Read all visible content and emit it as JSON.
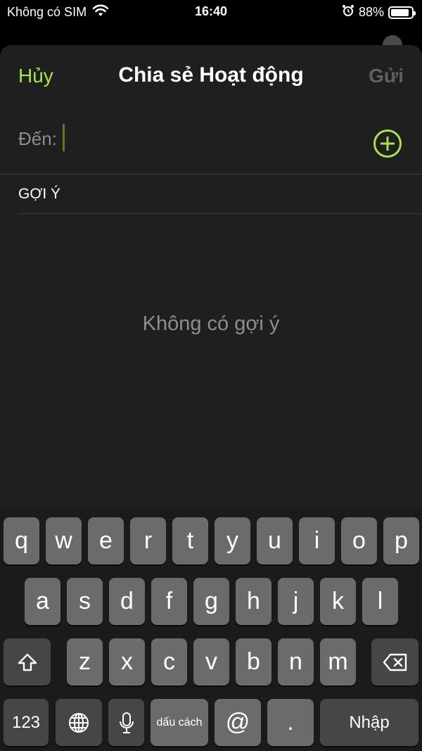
{
  "status_bar": {
    "carrier": "Không có SIM",
    "time": "16:40",
    "battery_percent": "88%",
    "battery_level": 0.88
  },
  "sheet": {
    "cancel_label": "Hủy",
    "title": "Chia sẻ Hoạt động",
    "send_label": "Gửi",
    "to_label": "Đến:",
    "section_header": "GỢI Ý",
    "empty_message": "Không có gợi ý"
  },
  "keyboard": {
    "row1": [
      "q",
      "w",
      "e",
      "r",
      "t",
      "y",
      "u",
      "i",
      "o",
      "p"
    ],
    "row2": [
      "a",
      "s",
      "d",
      "f",
      "g",
      "h",
      "j",
      "k",
      "l"
    ],
    "row3": [
      "z",
      "x",
      "c",
      "v",
      "b",
      "n",
      "m"
    ],
    "numbers_label": "123",
    "space_label": "dấu cách",
    "at_label": "@",
    "period_label": ".",
    "return_label": "Nhập"
  },
  "colors": {
    "accent": "#a6e34f",
    "background": "#1f1f1f",
    "key": "#6b6b6b",
    "key_special": "#464646"
  },
  "icons": [
    "wifi-icon",
    "alarm-icon",
    "battery-icon",
    "plus-circle-icon",
    "shift-icon",
    "delete-icon",
    "globe-icon",
    "microphone-icon"
  ]
}
